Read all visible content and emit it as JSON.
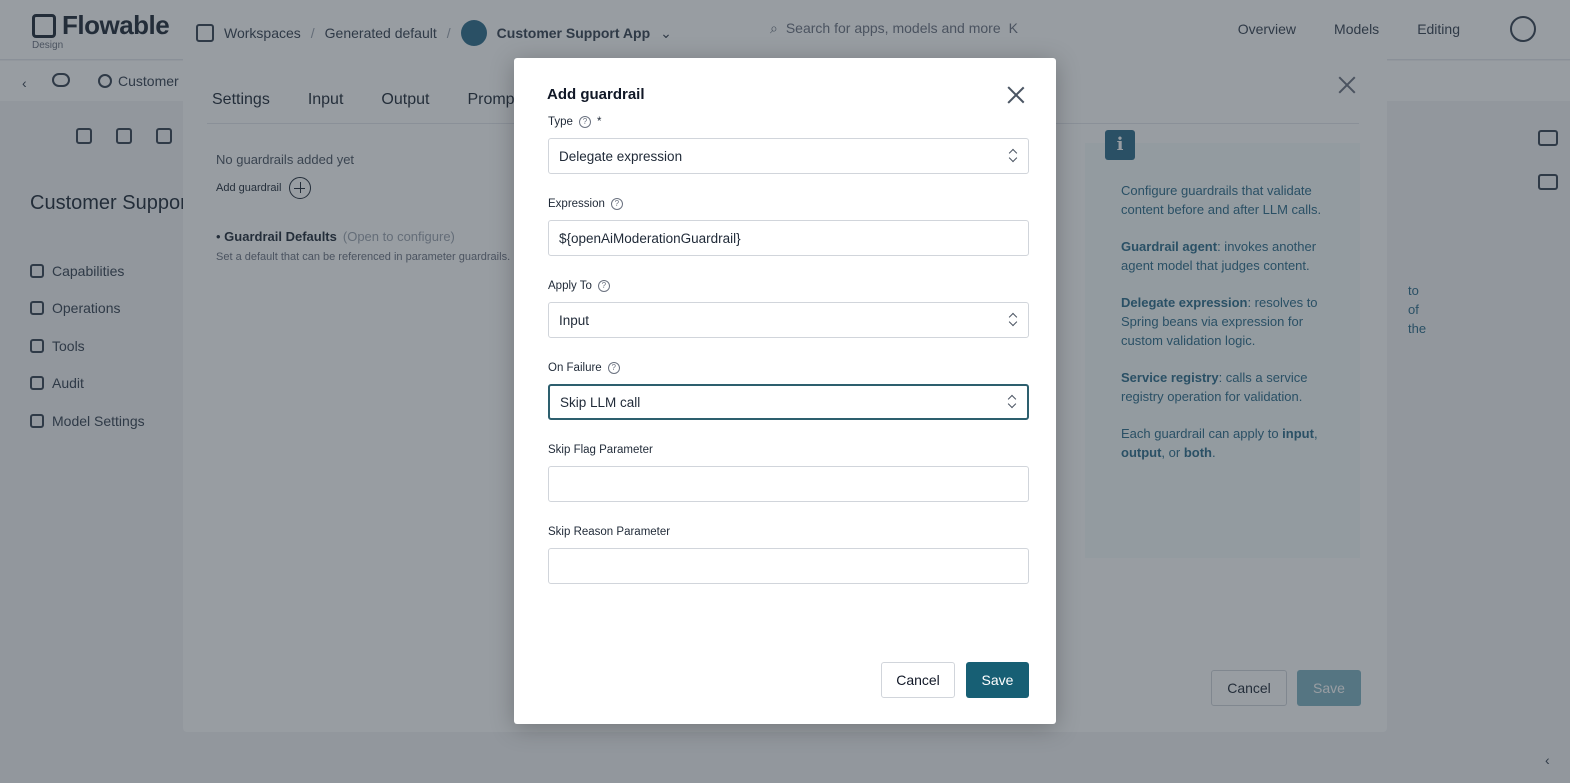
{
  "topbar": {
    "logo_text": "Flowable",
    "logo_sub": "Design",
    "workspaces_label": "Workspaces",
    "workspace_name": "Generated default",
    "app_name": "Customer Support App",
    "search_placeholder": "Search for apps, models and more",
    "search_shortcut": "K",
    "nav": [
      "Overview",
      "Models",
      "Editing"
    ]
  },
  "subbar": {
    "crumb": "Customer"
  },
  "sidebar": {
    "title": "Customer Support",
    "items": [
      {
        "label": "Capabilities",
        "icon": "sliders-icon"
      },
      {
        "label": "Operations",
        "icon": "operations-icon"
      },
      {
        "label": "Tools",
        "icon": "wrench-icon"
      },
      {
        "label": "Audit",
        "icon": "chart-icon"
      },
      {
        "label": "Model Settings",
        "icon": "wrench-icon"
      }
    ]
  },
  "panel": {
    "tabs": [
      "Settings",
      "Input",
      "Output",
      "Promp"
    ],
    "no_guardrails": "No guardrails added yet",
    "add_guardrail": "Add guardrail",
    "defaults_title": "Guardrail Defaults",
    "defaults_hint": "(Open to configure)",
    "defaults_help": "Set a default that can be referenced in parameter guardrails.",
    "info": {
      "p1": "Configure guardrails that validate content before and after LLM calls.",
      "p2_bold": "Guardrail agent",
      "p2": ": invokes another agent model that judges content.",
      "p3_bold": "Delegate expression",
      "p3": ": resolves to Spring beans via expression for custom validation logic.",
      "p4_bold": "Service registry",
      "p4": ": calls a service registry operation for validation.",
      "p5_pre": "Each guardrail can apply to",
      "p5_input": "input",
      "p5_output": "output",
      "p5_or": ", or",
      "p5_both": "both",
      "bleed_1": "to",
      "bleed_2": "of the"
    },
    "cancel_label": "Cancel",
    "save_label": "Save"
  },
  "dialog": {
    "title": "Add guardrail",
    "type": {
      "label": "Type",
      "required_mark": "*",
      "value": "Delegate expression"
    },
    "expression": {
      "label": "Expression",
      "value": "${openAiModerationGuardrail}"
    },
    "apply_to": {
      "label": "Apply To",
      "value": "Input"
    },
    "on_failure": {
      "label": "On Failure",
      "value": "Skip LLM call"
    },
    "skip_flag": {
      "label": "Skip Flag Parameter",
      "value": ""
    },
    "skip_reason": {
      "label": "Skip Reason Parameter",
      "value": ""
    },
    "cancel_label": "Cancel",
    "save_label": "Save"
  },
  "colors": {
    "primary": "#175f74",
    "info_text": "#2d6b8a",
    "overlay": "rgba(40,50,60,0.48)"
  }
}
